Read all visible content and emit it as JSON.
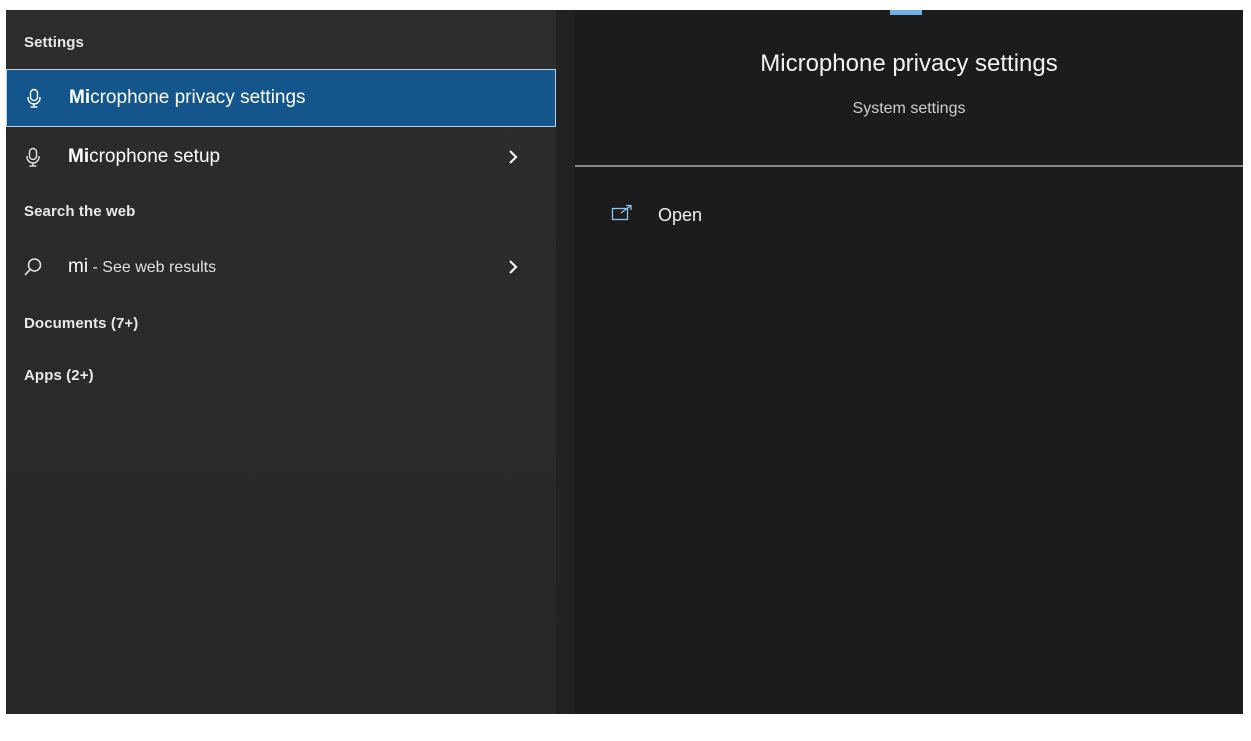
{
  "results": {
    "sections": {
      "settings": "Settings",
      "web": "Search the web",
      "documents": "Documents (7+)",
      "apps": "Apps (2+)"
    },
    "items": [
      {
        "match": "Mi",
        "rest": "crophone privacy settings",
        "icon": "microphone-icon",
        "selected": true
      },
      {
        "match": "Mi",
        "rest": "crophone setup",
        "icon": "microphone-icon",
        "selected": false
      },
      {
        "query": "mi",
        "suffix": " - See web results",
        "icon": "search-icon"
      }
    ]
  },
  "detail": {
    "title": "Microphone privacy settings",
    "subtitle": "System settings",
    "actions": [
      {
        "label": "Open",
        "icon": "open-external-icon"
      }
    ]
  },
  "colors": {
    "left_bg": "#2b2b2b",
    "right_bg": "#1c1c1c",
    "selected_bg": "#14568c",
    "accent": "#6fb2e6"
  }
}
